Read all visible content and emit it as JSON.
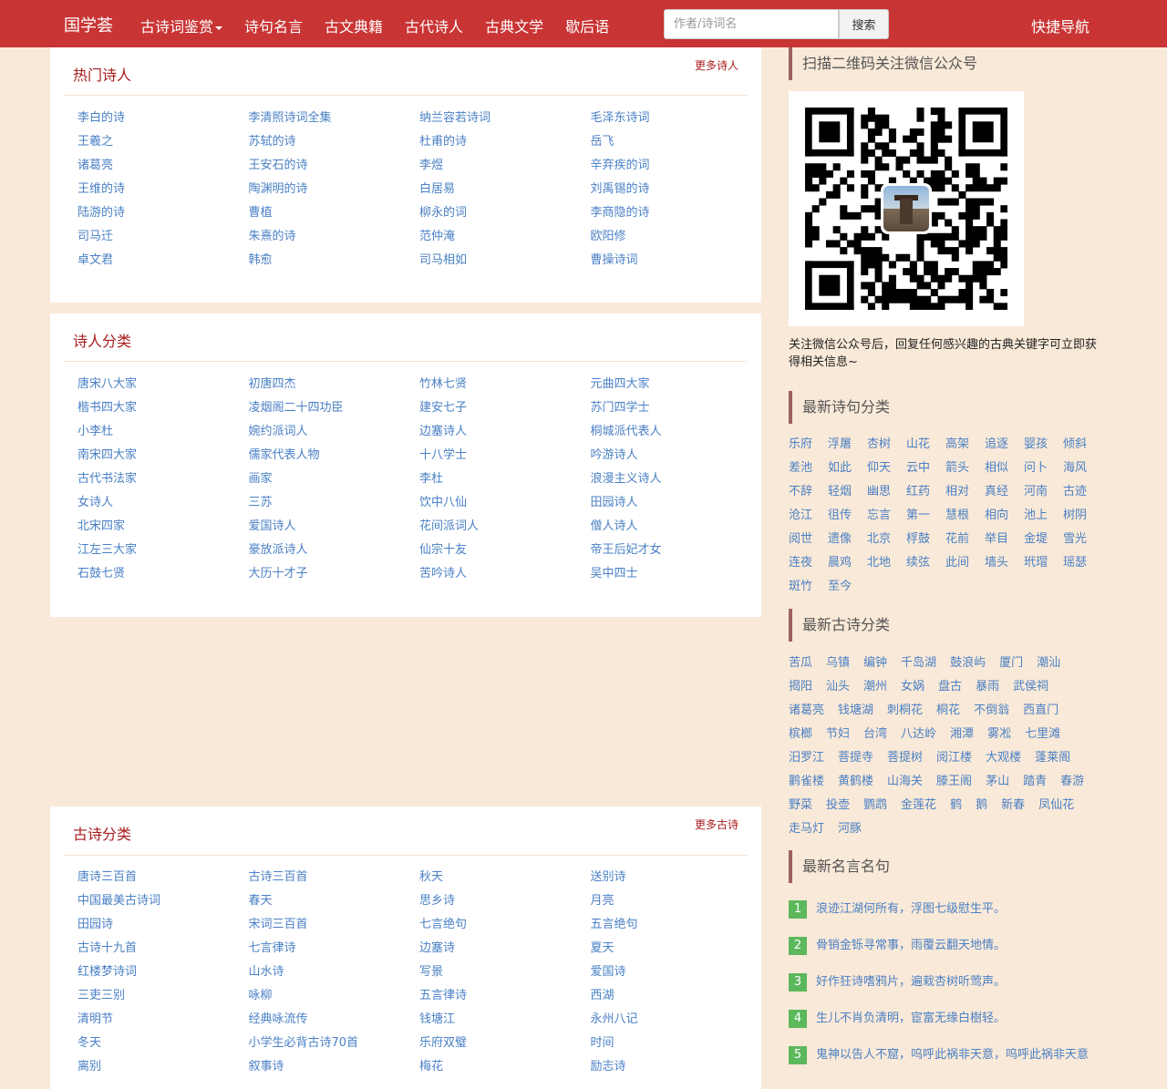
{
  "nav": {
    "brand": "国学荟",
    "items": [
      "古诗词鉴赏",
      "诗句名言",
      "古文典籍",
      "古代诗人",
      "古典文学",
      "歇后语"
    ],
    "search_placeholder": "作者/诗词名",
    "search_button": "搜索",
    "quick_nav": "快捷导航"
  },
  "hot_poets": {
    "title": "热门诗人",
    "more": "更多诗人",
    "items": [
      "李白的诗",
      "李清照诗词全集",
      "纳兰容若诗词",
      "毛泽东诗词",
      "王羲之",
      "苏轼的诗",
      "杜甫的诗",
      "岳飞",
      "诸葛亮",
      "王安石的诗",
      "李煜",
      "辛弃疾的词",
      "王维的诗",
      "陶渊明的诗",
      "白居易",
      "刘禹锡的诗",
      "陆游的诗",
      "曹植",
      "柳永的词",
      "李商隐的诗",
      "司马迁",
      "朱熹的诗",
      "范仲淹",
      "欧阳修",
      "卓文君",
      "韩愈",
      "司马相如",
      "曹操诗词"
    ]
  },
  "poet_categories": {
    "title": "诗人分类",
    "items": [
      "唐宋八大家",
      "初唐四杰",
      "竹林七贤",
      "元曲四大家",
      "楷书四大家",
      "凌烟阁二十四功臣",
      "建安七子",
      "苏门四学士",
      "小李杜",
      "婉约派词人",
      "边塞诗人",
      "桐城派代表人",
      "南宋四大家",
      "儒家代表人物",
      "十八学士",
      "吟游诗人",
      "古代书法家",
      "画家",
      "李杜",
      "浪漫主义诗人",
      "女诗人",
      "三苏",
      "饮中八仙",
      "田园诗人",
      "北宋四家",
      "爱国诗人",
      "花间派词人",
      "僧人诗人",
      "江左三大家",
      "豪放派诗人",
      "仙宗十友",
      "帝王后妃才女",
      "石鼓七贤",
      "大历十才子",
      "苦吟诗人",
      "吴中四士"
    ]
  },
  "poem_categories": {
    "title": "古诗分类",
    "more": "更多古诗",
    "items": [
      "唐诗三百首",
      "古诗三百首",
      "秋天",
      "送别诗",
      "中国最美古诗词",
      "春天",
      "思乡诗",
      "月亮",
      "田园诗",
      "宋词三百首",
      "七言绝句",
      "五言绝句",
      "古诗十九首",
      "七言律诗",
      "边塞诗",
      "夏天",
      "红楼梦诗词",
      "山水诗",
      "写景",
      "爱国诗",
      "三吏三别",
      "咏柳",
      "五言律诗",
      "西湖",
      "清明节",
      "经典咏流传",
      "钱塘江",
      "永州八记",
      "冬天",
      "小学生必背古诗70首",
      "乐府双璧",
      "时间",
      "离别",
      "叙事诗",
      "梅花",
      "励志诗"
    ]
  },
  "wechat": {
    "title": "扫描二维码关注微信公众号",
    "caption": "关注微信公众号后，回复任何感兴趣的古典关键字可立即获得相关信息~"
  },
  "latest_verse_categories": {
    "title": "最新诗句分类",
    "items": [
      "乐府",
      "浮屠",
      "杏树",
      "山花",
      "高架",
      "追逐",
      "婴孩",
      "倾斜",
      "差池",
      "如此",
      "仰天",
      "云中",
      "箭头",
      "相似",
      "问卜",
      "海风",
      "不辞",
      "轻烟",
      "幽思",
      "红药",
      "相对",
      "真经",
      "河南",
      "古迹",
      "沧江",
      "徂传",
      "忘言",
      "第一",
      "慧根",
      "相向",
      "池上",
      "树阴",
      "阅世",
      "遗像",
      "北京",
      "桴鼓",
      "花前",
      "举目",
      "金堤",
      "雪光",
      "连夜",
      "晨鸡",
      "北地",
      "续弦",
      "此间",
      "墙头",
      "玳瑁",
      "瑶瑟",
      "斑竹",
      "至今"
    ]
  },
  "latest_poem_categories": {
    "title": "最新古诗分类",
    "items": [
      "苦瓜",
      "乌镇",
      "编钟",
      "千岛湖",
      "鼓浪屿",
      "厦门",
      "潮汕",
      "揭阳",
      "汕头",
      "潮州",
      "女娲",
      "盘古",
      "暴雨",
      "武侯祠",
      "诸葛亮",
      "钱塘湖",
      "刺桐花",
      "桐花",
      "不倒翁",
      "西直门",
      "槟榔",
      "节妇",
      "台湾",
      "八达岭",
      "湘潭",
      "雾凇",
      "七里滩",
      "汨罗江",
      "菩提寺",
      "菩提树",
      "阅江楼",
      "大观楼",
      "蓬莱阁",
      "鹳雀楼",
      "黄鹤楼",
      "山海关",
      "滕王阁",
      "茅山",
      "踏青",
      "春游",
      "野菜",
      "投壶",
      "鹦鹉",
      "金莲花",
      "鹤",
      "鹅",
      "新春",
      "凤仙花",
      "走马灯",
      "河豚"
    ]
  },
  "latest_quotes": {
    "title": "最新名言名句",
    "items": [
      {
        "num": "1",
        "text": "浪迹江湖何所有，浮图七级慰生平。"
      },
      {
        "num": "2",
        "text": "骨销金铄寻常事，雨覆云翻天地情。"
      },
      {
        "num": "3",
        "text": "好作狂诗嗜鸦片，遍栽杏树听莺声。"
      },
      {
        "num": "4",
        "text": "生儿不肖负清明，宦富无缘白樹轻。"
      },
      {
        "num": "5",
        "text": "鬼神以告人不窟，呜呼此祸非天意，呜呼此祸非天意"
      }
    ]
  }
}
